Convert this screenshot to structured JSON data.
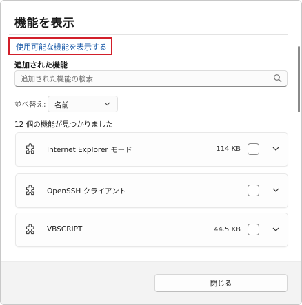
{
  "dialog": {
    "title": "機能を表示",
    "show_available_link": "使用可能な機能を表示する",
    "added_features_label": "追加された機能",
    "search": {
      "placeholder": "追加された機能の検索",
      "value": "",
      "icon": "search-icon"
    },
    "sort": {
      "label": "並べ替え:",
      "selected": "名前",
      "icon": "chevron-down-icon"
    },
    "count_text": "12 個の機能が見つかりました",
    "features": [
      {
        "name": "Internet Explorer モード",
        "size": "114 KB",
        "checked": false,
        "icon": "puzzle-icon"
      },
      {
        "name": "OpenSSH クライアント",
        "size": "",
        "checked": false,
        "icon": "puzzle-icon"
      },
      {
        "name": "VBSCRIPT",
        "size": "44.5 KB",
        "checked": false,
        "icon": "puzzle-icon"
      }
    ],
    "close_button": "閉じる",
    "highlight_color": "#d21f2a",
    "link_color": "#1a5aa8"
  }
}
